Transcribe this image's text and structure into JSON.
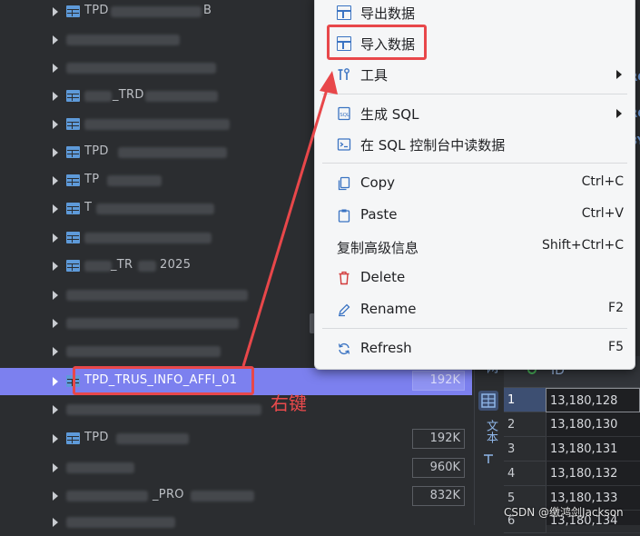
{
  "tree": {
    "rows": [
      {
        "name": "TPD",
        "visible_suffix": "B"
      },
      {
        "name": ""
      },
      {
        "name": ""
      },
      {
        "name": "_TRD"
      },
      {
        "name": ""
      },
      {
        "name": "TPD"
      },
      {
        "name": "TP"
      },
      {
        "name": "T"
      },
      {
        "name": ""
      },
      {
        "name": "_TR",
        "visible_suffix": "2025"
      },
      {
        "name": ""
      },
      {
        "name": ""
      },
      {
        "name": ""
      },
      {
        "name": "TPD_TRUS_INFO_AFFI_01",
        "selected": true
      },
      {
        "name": ""
      },
      {
        "name": "TPD"
      },
      {
        "name": ""
      },
      {
        "name": "_PRO"
      },
      {
        "name": ""
      }
    ],
    "sizes": [
      {
        "label": "192K",
        "selected": true
      },
      {
        "label": "192K"
      },
      {
        "label": "960K"
      },
      {
        "label": "832K"
      }
    ]
  },
  "context_menu": {
    "export_data": "导出数据",
    "import_data": "导入数据",
    "tools": "工具",
    "generate_sql": "生成 SQL",
    "read_in_console": "在 SQL 控制台中读数据",
    "copy": "Copy",
    "copy_shortcut": "Ctrl+C",
    "paste": "Paste",
    "paste_shortcut": "Ctrl+V",
    "copy_advanced": "复制高级信息",
    "copy_advanced_shortcut": "Shift+Ctrl+C",
    "delete": "Delete",
    "rename": "Rename",
    "rename_shortcut": "F2",
    "refresh": "Refresh",
    "refresh_shortcut": "F5"
  },
  "annotation": {
    "right_click": "右键"
  },
  "result_panel": {
    "tab_grid": "网",
    "tab_text": "文本",
    "column_header": "ID",
    "rows": [
      {
        "num": "1",
        "value": "13,180,128"
      },
      {
        "num": "2",
        "value": "13,180,130"
      },
      {
        "num": "3",
        "value": "13,180,131"
      },
      {
        "num": "4",
        "value": "13,180,132"
      },
      {
        "num": "5",
        "value": "13,180,133"
      },
      {
        "num": "6",
        "value": "13,180,134"
      }
    ]
  },
  "watermark": "CSDN @缴鸿剑Jackson",
  "colors": {
    "selection": "#7c80ef",
    "highlight_red": "#e8474a",
    "menu_bg": "#f5f6f7"
  }
}
